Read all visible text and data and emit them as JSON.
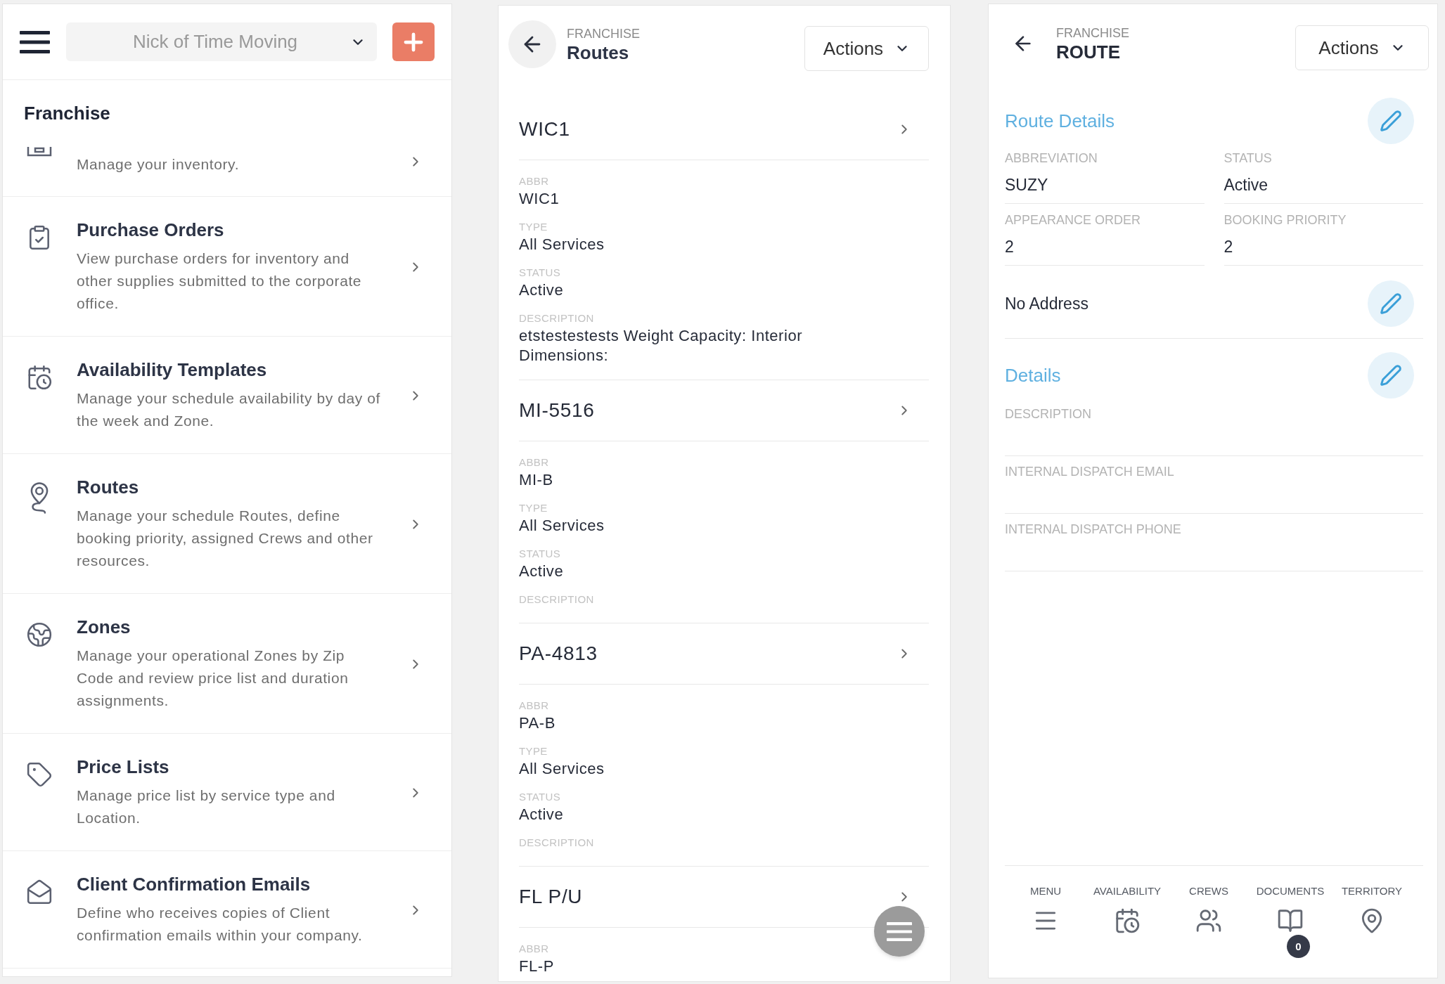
{
  "menu_panel": {
    "company_select": {
      "value": "Nick of Time Moving"
    },
    "section_title": "Franchise",
    "items": [
      {
        "description": "Manage your inventory."
      },
      {
        "title": "Purchase Orders",
        "description": "View purchase orders for inventory and other supplies submitted to the corporate office."
      },
      {
        "title": "Availability Templates",
        "description": "Manage your schedule availability by day of the week and Zone."
      },
      {
        "title": "Routes",
        "description": "Manage your schedule Routes, define booking priority, assigned Crews and other resources."
      },
      {
        "title": "Zones",
        "description": "Manage your operational Zones by Zip Code and review price list and duration assignments."
      },
      {
        "title": "Price Lists",
        "description": "Manage price list by service type and Location."
      },
      {
        "title": "Client Confirmation Emails",
        "description": "Define who receives copies of Client confirmation emails within your company."
      }
    ]
  },
  "routes_panel": {
    "breadcrumb": "FRANCHISE",
    "title": "Routes",
    "actions": "Actions",
    "routes": [
      {
        "name": "WIC1",
        "fields": [
          {
            "label": "ABBR",
            "value": "WIC1"
          },
          {
            "label": "TYPE",
            "value": "All Services"
          },
          {
            "label": "STATUS",
            "value": "Active"
          },
          {
            "label": "DESCRIPTION",
            "value": "etstestestests Weight Capacity: Interior Dimensions:"
          }
        ]
      },
      {
        "name": "MI-5516",
        "fields": [
          {
            "label": "ABBR",
            "value": "MI-B"
          },
          {
            "label": "TYPE",
            "value": "All Services"
          },
          {
            "label": "STATUS",
            "value": "Active"
          },
          {
            "label": "DESCRIPTION"
          }
        ]
      },
      {
        "name": "PA-4813",
        "fields": [
          {
            "label": "ABBR",
            "value": "PA-B"
          },
          {
            "label": "TYPE",
            "value": "All Services"
          },
          {
            "label": "STATUS",
            "value": "Active"
          },
          {
            "label": "DESCRIPTION"
          }
        ]
      },
      {
        "name": "FL P/U",
        "fields": [
          {
            "label": "ABBR",
            "value": "FL-P"
          }
        ]
      }
    ]
  },
  "route_panel": {
    "breadcrumb": "FRANCHISE",
    "title": "ROUTE",
    "actions": "Actions",
    "route_details": {
      "title": "Route Details",
      "fields": [
        {
          "label": "ABBREVIATION",
          "value": "SUZY"
        },
        {
          "label": "STATUS",
          "value": "Active"
        },
        {
          "label": "APPEARANCE ORDER",
          "value": "2"
        },
        {
          "label": "BOOKING PRIORITY",
          "value": "2"
        }
      ]
    },
    "address": "No Address",
    "details": {
      "title": "Details",
      "fields": [
        {
          "label": "DESCRIPTION"
        },
        {
          "label": "INTERNAL DISPATCH EMAIL"
        },
        {
          "label": "INTERNAL DISPATCH PHONE"
        }
      ]
    },
    "bottom_nav": [
      {
        "label": "MENU"
      },
      {
        "label": "AVAILABILITY"
      },
      {
        "label": "CREWS"
      },
      {
        "label": "DOCUMENTS",
        "badge": "0"
      },
      {
        "label": "TERRITORY"
      }
    ]
  }
}
